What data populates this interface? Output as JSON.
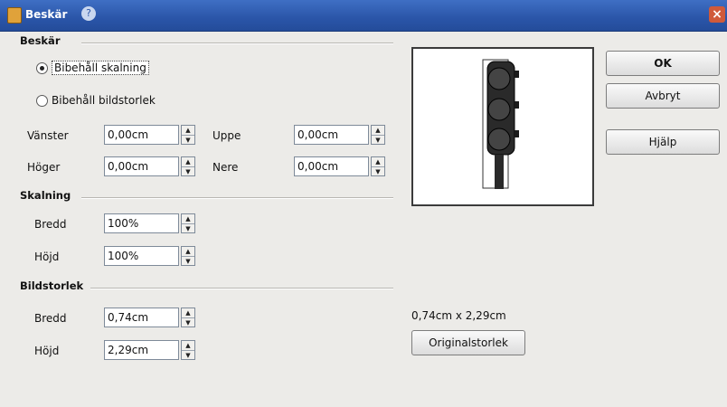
{
  "window": {
    "title": "Beskär"
  },
  "crop": {
    "heading": "Beskär",
    "keep_scale": "Bibehåll skalning",
    "keep_size": "Bibehåll bildstorlek",
    "left_label": "Vänster",
    "left_value": "0,00cm",
    "right_label": "Höger",
    "right_value": "0,00cm",
    "top_label": "Uppe",
    "top_value": "0,00cm",
    "bottom_label": "Nere",
    "bottom_value": "0,00cm"
  },
  "scale": {
    "heading": "Skalning",
    "width_label": "Bredd",
    "width_value": "100%",
    "height_label": "Höjd",
    "height_value": "100%"
  },
  "image_size": {
    "heading": "Bildstorlek",
    "width_label": "Bredd",
    "width_value": "0,74cm",
    "height_label": "Höjd",
    "height_value": "2,29cm"
  },
  "preview": {
    "dimensions": "0,74cm x 2,29cm",
    "original_size_button": "Originalstorlek"
  },
  "buttons": {
    "ok": "OK",
    "cancel": "Avbryt",
    "help": "Hjälp"
  }
}
